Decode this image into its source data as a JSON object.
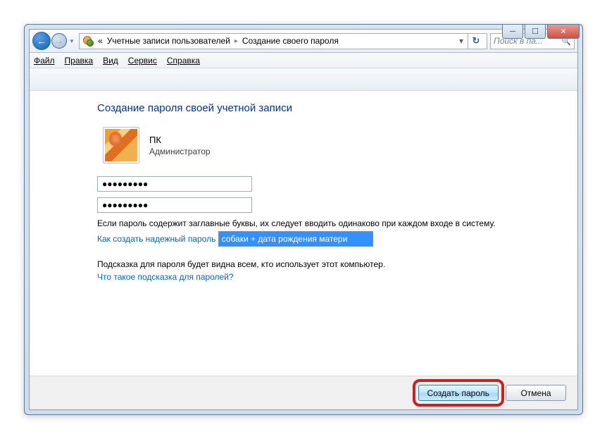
{
  "titlebar": {
    "minimize": "─",
    "maximize": "☐",
    "close": "✕"
  },
  "navbar": {
    "back": "←",
    "forward": "→",
    "dropdown": "▼",
    "breadcrumb_prefix": "«",
    "breadcrumb1": "Учетные записи пользователей",
    "breadcrumb2": "Создание своего пароля",
    "sep": "▸",
    "addr_dropdown": "▾",
    "refresh": "↻",
    "search_placeholder": "Поиск в па...",
    "search_icon": "🔍"
  },
  "menubar": {
    "file": "Файл",
    "edit": "Правка",
    "view": "Вид",
    "tools": "Сервис",
    "help": "Справка"
  },
  "content": {
    "heading": "Создание пароля своей учетной записи",
    "user_name": "ПК",
    "user_role": "Администратор",
    "password1": "●●●●●●●●●",
    "password2": "●●●●●●●●●",
    "caps_text": "Если пароль содержит заглавные буквы, их следует вводить одинаково при каждом входе в систему.",
    "link1": "Как создать надежный пароль",
    "hint_value": "собаки + дата рождения матери",
    "hint_text": "Подсказка для пароля будет видна всем, кто использует этот компьютер.",
    "link2": "Что такое подсказка для паролей?"
  },
  "footer": {
    "create": "Создать пароль",
    "cancel": "Отмена"
  }
}
